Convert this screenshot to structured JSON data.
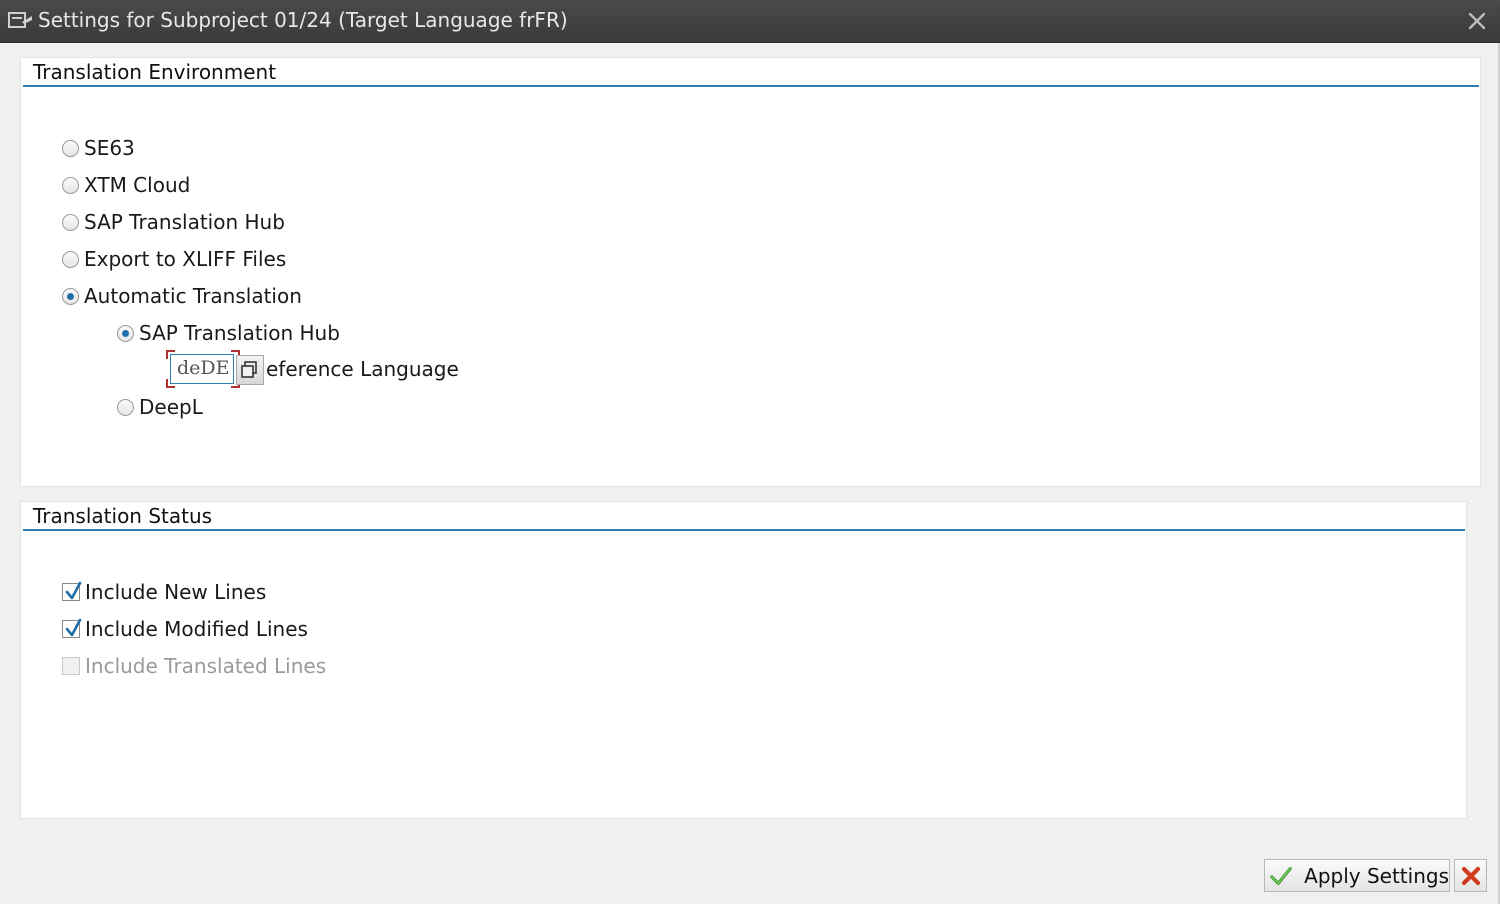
{
  "window": {
    "title": "Settings for Subproject 01/24 (Target Language frFR)"
  },
  "translation_environment": {
    "title": "Translation Environment",
    "options": [
      {
        "label": "SE63",
        "checked": false
      },
      {
        "label": "XTM Cloud",
        "checked": false
      },
      {
        "label": "SAP Translation Hub",
        "checked": false
      },
      {
        "label": "Export to XLIFF Files",
        "checked": false
      },
      {
        "label": "Automatic Translation",
        "checked": true
      }
    ],
    "automatic_sub_options": [
      {
        "label": "SAP Translation Hub",
        "checked": true
      },
      {
        "label": "DeepL",
        "checked": false
      }
    ],
    "reference_language": {
      "value": "deDE",
      "label": "eference Language"
    }
  },
  "translation_status": {
    "title": "Translation Status",
    "checkboxes": [
      {
        "label": "Include New Lines",
        "checked": true,
        "enabled": true
      },
      {
        "label": "Include Modified Lines",
        "checked": true,
        "enabled": true
      },
      {
        "label": "Include Translated Lines",
        "checked": false,
        "enabled": false
      }
    ]
  },
  "footer": {
    "apply_label": "Apply Settings"
  },
  "icons": {
    "title": "window-menu-icon",
    "close": "close-icon",
    "f4": "value-help-icon",
    "apply": "checkmark-icon",
    "cancel": "cancel-x-icon"
  },
  "colors": {
    "accent": "#2f7fb0",
    "titlebar": "#3f3f3f",
    "radio_dot": "#1f6fa6",
    "apply_check": "#3e9b2e",
    "cancel_x": "#d23c1e"
  }
}
